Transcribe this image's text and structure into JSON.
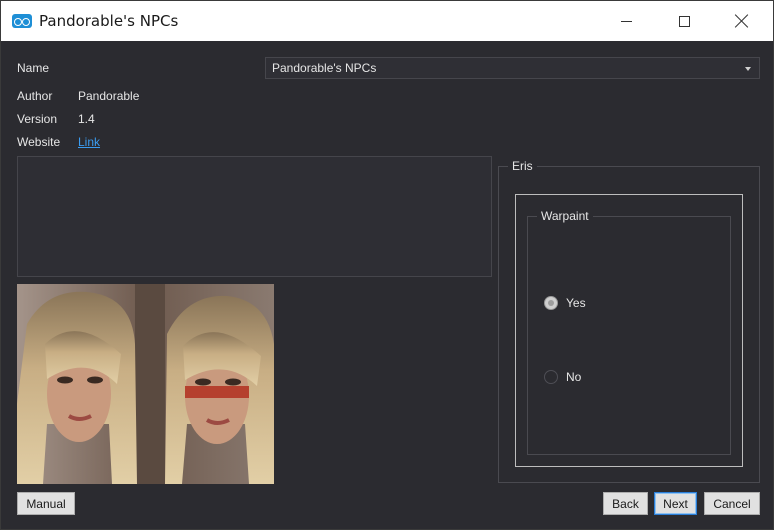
{
  "window": {
    "title": "Pandorable's NPCs",
    "controls": {
      "minimize": "minimize-icon",
      "maximize": "maximize-icon",
      "close": "close-icon"
    }
  },
  "info": {
    "name_label": "Name",
    "author_label": "Author",
    "author_value": "Pandorable",
    "version_label": "Version",
    "version_value": "1.4",
    "website_label": "Website",
    "website_link": "Link"
  },
  "selector": {
    "selected": "Pandorable's NPCs"
  },
  "description": "",
  "preview": {
    "image": "side-by-side preview: female NPC without and with red warpaint"
  },
  "options": {
    "group_title": "Eris",
    "subgroup_title": "Warpaint",
    "choices": [
      {
        "label": "Yes",
        "selected": true
      },
      {
        "label": "No",
        "selected": false
      }
    ]
  },
  "buttons": {
    "manual": "Manual",
    "back": "Back",
    "next": "Next",
    "cancel": "Cancel"
  },
  "colors": {
    "background": "#2b2b30",
    "titlebar": "#ffffff",
    "link": "#3b9cf0",
    "focus_border": "#2a7ed8"
  }
}
